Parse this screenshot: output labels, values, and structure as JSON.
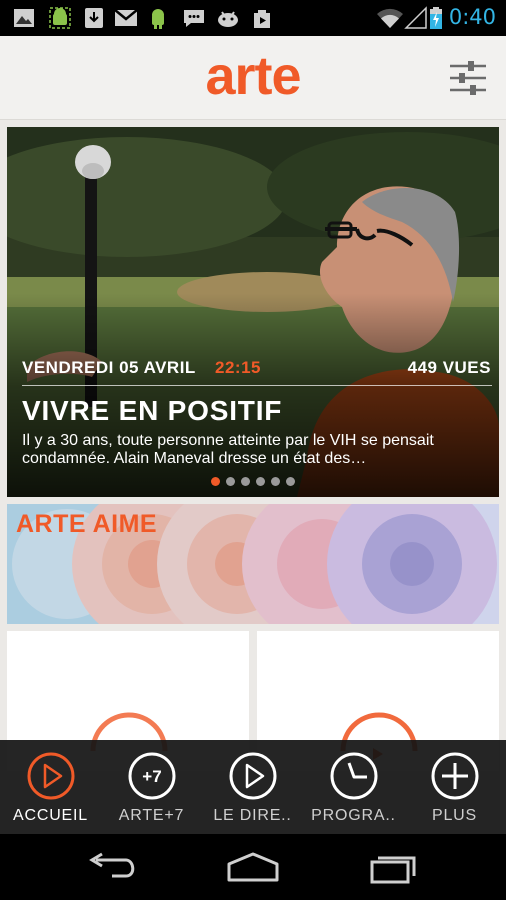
{
  "status_bar": {
    "time": "0:40",
    "notification_icons": [
      "gallery-icon",
      "android-debug-icon",
      "download-icon",
      "gmail-icon",
      "android-icon",
      "chat-icon",
      "android-game-icon",
      "play-store-icon"
    ],
    "system_icons": [
      "wifi-icon",
      "signal-icon",
      "battery-charging-icon"
    ]
  },
  "header": {
    "logo_text": "arte",
    "settings_icon": "sliders-icon"
  },
  "hero": {
    "date": "VENDREDI 05 AVRIL",
    "time": "22:15",
    "views": "449 VUES",
    "title": "VIVRE EN POSITIF",
    "description": "Il y a 30 ans, toute personne atteinte par le VIH se pensait condamnée. Alain Maneval dresse un état des…",
    "carousel": {
      "count": 6,
      "active_index": 0
    }
  },
  "promo": {
    "label": "ARTE AIME"
  },
  "bottom_nav": {
    "items": [
      {
        "label": "ACCUEIL",
        "icon": "play-icon",
        "active": true
      },
      {
        "label": "ARTE+7",
        "icon": "plus7-icon",
        "active": false
      },
      {
        "label": "LE DIRE..",
        "icon": "play-icon",
        "active": false
      },
      {
        "label": "PROGRA..",
        "icon": "clock-icon",
        "active": false
      },
      {
        "label": "PLUS",
        "icon": "plus-icon",
        "active": false
      }
    ],
    "plus7_glyph": "+7"
  },
  "system_nav": {
    "icons": [
      "back-icon",
      "home-icon",
      "recent-apps-icon"
    ]
  },
  "colors": {
    "accent": "#f05a28",
    "clock": "#33b5e5",
    "header_bg": "#f2f1ef",
    "content_bg": "#ebe9e6"
  }
}
